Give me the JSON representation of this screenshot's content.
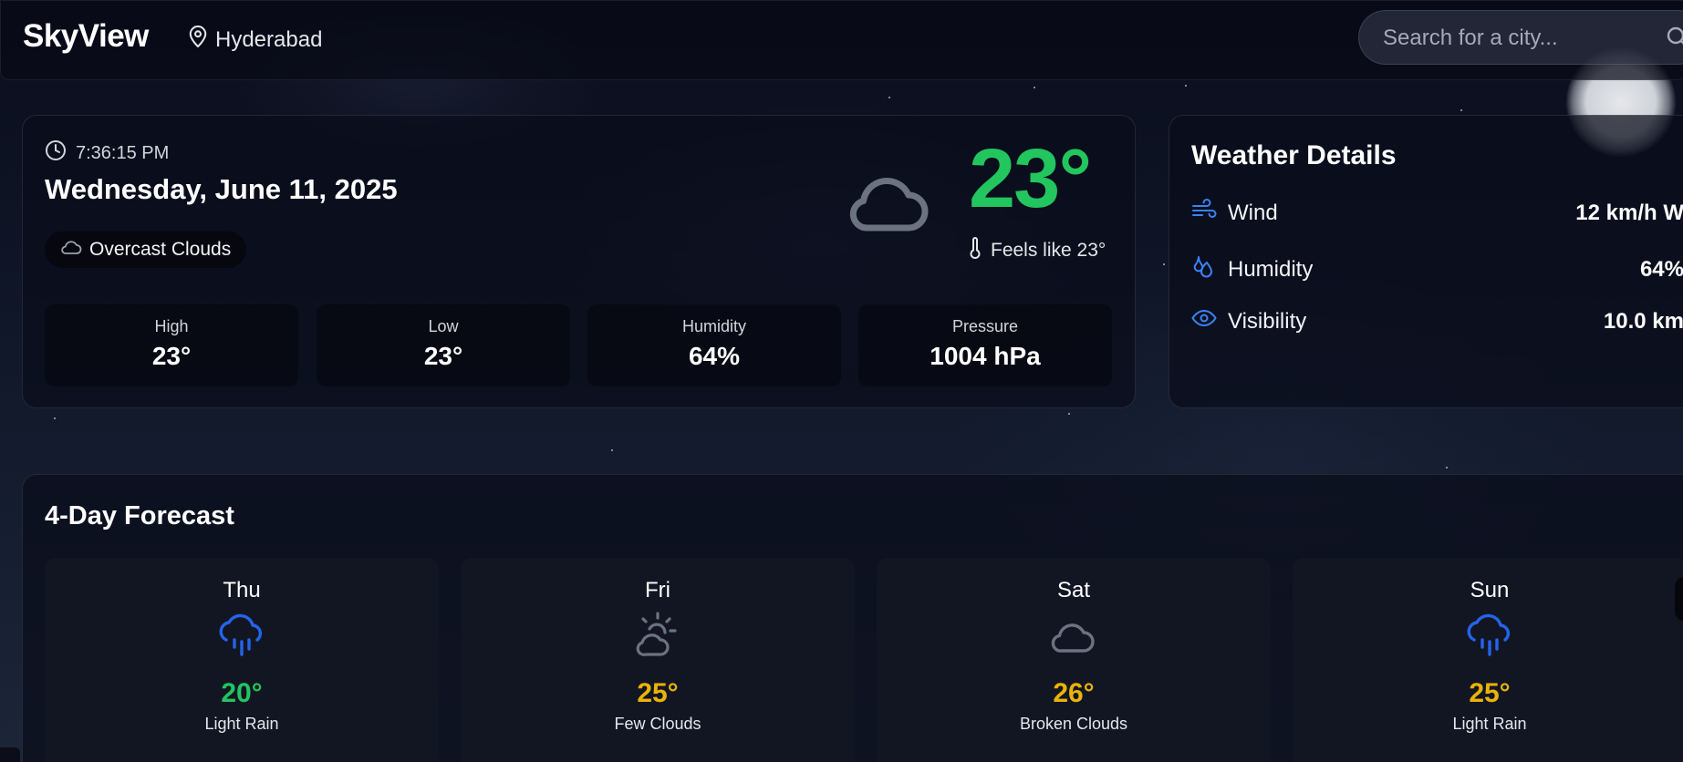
{
  "header": {
    "brand": "SkyView",
    "location": "Hyderabad",
    "search_placeholder": "Search for a city..."
  },
  "current": {
    "time": "7:36:15 PM",
    "date": "Wednesday, June 11, 2025",
    "condition": "Overcast Clouds",
    "temperature": "23°",
    "feels_like": "Feels like 23°",
    "temp_color": "#22c55e",
    "stats": [
      {
        "label": "High",
        "value": "23°"
      },
      {
        "label": "Low",
        "value": "23°"
      },
      {
        "label": "Humidity",
        "value": "64%"
      },
      {
        "label": "Pressure",
        "value": "1004 hPa"
      }
    ]
  },
  "details": {
    "title": "Weather Details",
    "rows": [
      {
        "icon": "wind-icon",
        "label": "Wind",
        "value": "12 km/h W"
      },
      {
        "icon": "droplets-icon",
        "label": "Humidity",
        "value": "64%"
      },
      {
        "icon": "eye-icon",
        "label": "Visibility",
        "value": "10.0 km"
      }
    ],
    "accent": "#3b82f6"
  },
  "forecast": {
    "title": "4-Day Forecast",
    "days": [
      {
        "day": "Thu",
        "icon": "cloud-rain-icon",
        "temp": "20°",
        "desc": "Light Rain",
        "temp_color": "#22c55e"
      },
      {
        "day": "Fri",
        "icon": "cloud-sun-icon",
        "temp": "25°",
        "desc": "Few Clouds",
        "temp_color": "#eab308"
      },
      {
        "day": "Sat",
        "icon": "cloud-icon",
        "temp": "26°",
        "desc": "Broken Clouds",
        "temp_color": "#eab308"
      },
      {
        "day": "Sun",
        "icon": "cloud-rain-icon",
        "temp": "25°",
        "desc": "Light Rain",
        "temp_color": "#eab308"
      }
    ]
  }
}
